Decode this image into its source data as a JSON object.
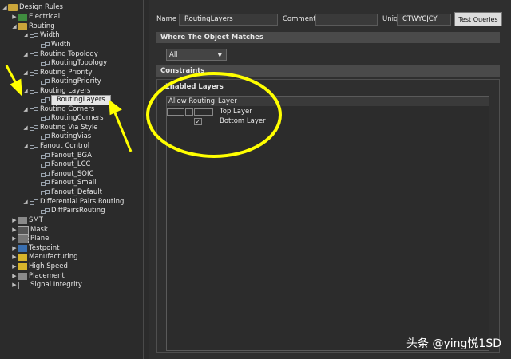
{
  "tree": {
    "items": [
      {
        "label": "Design Rules",
        "icon": "design-rules-folder-icon"
      },
      {
        "label": "Electrical",
        "icon": "electrical-icon"
      },
      {
        "label": "Routing",
        "icon": "routing-folder-icon"
      },
      {
        "label": "Width",
        "icon": "rule-group-icon"
      },
      {
        "label": "Width",
        "icon": "rule-icon"
      },
      {
        "label": "Routing Topology",
        "icon": "rule-group-icon"
      },
      {
        "label": "RoutingTopology",
        "icon": "rule-icon"
      },
      {
        "label": "Routing Priority",
        "icon": "rule-group-icon"
      },
      {
        "label": "RoutingPriority",
        "icon": "rule-icon"
      },
      {
        "label": "Routing Layers",
        "icon": "rule-group-icon"
      },
      {
        "label": "RoutingLayers",
        "icon": "rule-icon"
      },
      {
        "label": "Routing Corners",
        "icon": "rule-group-icon"
      },
      {
        "label": "RoutingCorners",
        "icon": "rule-icon"
      },
      {
        "label": "Routing Via Style",
        "icon": "rule-group-icon"
      },
      {
        "label": "RoutingVias",
        "icon": "rule-icon"
      },
      {
        "label": "Fanout Control",
        "icon": "rule-group-icon"
      },
      {
        "label": "Fanout_BGA",
        "icon": "rule-icon"
      },
      {
        "label": "Fanout_LCC",
        "icon": "rule-icon"
      },
      {
        "label": "Fanout_SOIC",
        "icon": "rule-icon"
      },
      {
        "label": "Fanout_Small",
        "icon": "rule-icon"
      },
      {
        "label": "Fanout_Default",
        "icon": "rule-icon"
      },
      {
        "label": "Differential Pairs Routing",
        "icon": "rule-group-icon"
      },
      {
        "label": "DiffPairsRouting",
        "icon": "rule-icon"
      },
      {
        "label": "SMT",
        "icon": "smt-icon"
      },
      {
        "label": "Mask",
        "icon": "mask-icon"
      },
      {
        "label": "Plane",
        "icon": "plane-icon"
      },
      {
        "label": "Testpoint",
        "icon": "testpoint-icon"
      },
      {
        "label": "Manufacturing",
        "icon": "manufacturing-icon"
      },
      {
        "label": "High Speed",
        "icon": "high-speed-icon"
      },
      {
        "label": "Placement",
        "icon": "placement-icon"
      },
      {
        "label": "Signal Integrity",
        "icon": "signal-integrity-icon"
      }
    ]
  },
  "form": {
    "name_label": "Name",
    "name_value": "RoutingLayers",
    "comment_label": "Comment",
    "comment_value": "",
    "uid_label": "Unique ID",
    "uid_value": "CTWYCJCY",
    "test_queries": "Test Queries"
  },
  "where": {
    "header": "Where The Object Matches",
    "scope_value": "All"
  },
  "constraints": {
    "header": "Constraints",
    "enabled_layers_title": "Enabled Layers",
    "col_allow": "Allow Routing",
    "col_layer": "Layer",
    "rows": [
      {
        "layer": "Top Layer",
        "allow": true
      },
      {
        "layer": "Bottom Layer",
        "allow": true
      }
    ]
  },
  "watermark": "头条 @ying悦1SD",
  "colors": {
    "annotation_yellow": "#ffff00",
    "selection_bg": "#e6e6e6"
  }
}
